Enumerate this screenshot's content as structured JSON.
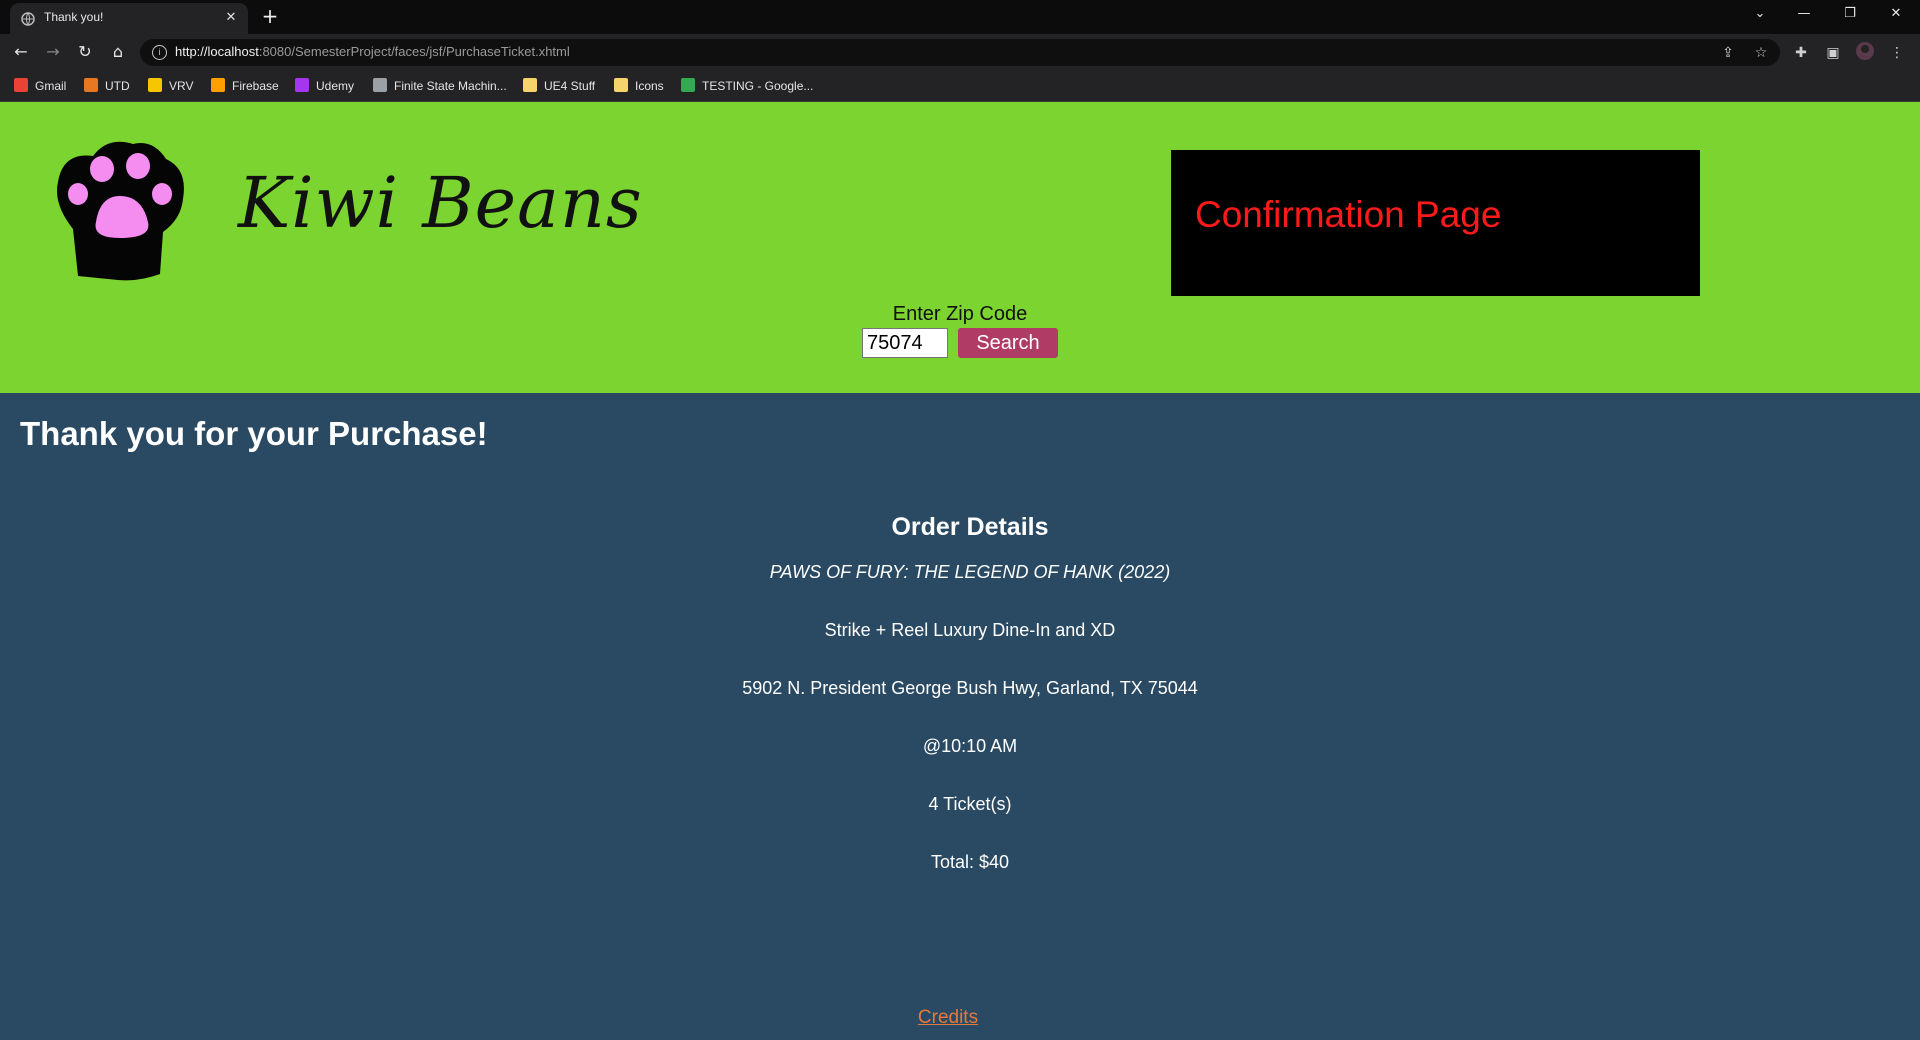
{
  "browser": {
    "tab_title": "Thank you!",
    "url_host": "http://localhost",
    "url_rest": ":8080/SemesterProject/faces/jsf/PurchaseTicket.xhtml",
    "bookmarks": [
      {
        "label": "Gmail",
        "color": "#ea4335"
      },
      {
        "label": "UTD",
        "color": "#e87722"
      },
      {
        "label": "VRV",
        "color": "#f7c600"
      },
      {
        "label": "Firebase",
        "color": "#ffa000"
      },
      {
        "label": "Udemy",
        "color": "#a435f0"
      },
      {
        "label": "Finite State Machin...",
        "color": "#9aa0a6"
      },
      {
        "label": "UE4 Stuff",
        "color": "#f6d36b"
      },
      {
        "label": "Icons",
        "color": "#f6d36b"
      },
      {
        "label": "TESTING - Google...",
        "color": "#34a853"
      }
    ]
  },
  "header": {
    "brand": "Kiwi Beans",
    "page_title": "Confirmation Page",
    "zip_label": "Enter Zip Code",
    "zip_value": "75074",
    "search_label": "Search"
  },
  "main": {
    "thanks": "Thank you for your Purchase!",
    "order_heading": "Order Details",
    "movie": "PAWS OF FURY: THE LEGEND OF HANK (2022)",
    "theater": "Strike + Reel Luxury Dine-In and XD",
    "address": "5902 N. President George Bush Hwy, Garland, TX 75044",
    "time": "@10:10 AM",
    "tickets": "4 Ticket(s)",
    "total": "Total: $40",
    "credits": "Credits"
  },
  "colors": {
    "header_bg": "#7bd42f",
    "main_bg": "#2a4a63",
    "search_button": "#b03c66",
    "confirmation_text": "#ff1a1a",
    "credits_link": "#e8793a",
    "paw_pad": "#f58cf0"
  }
}
